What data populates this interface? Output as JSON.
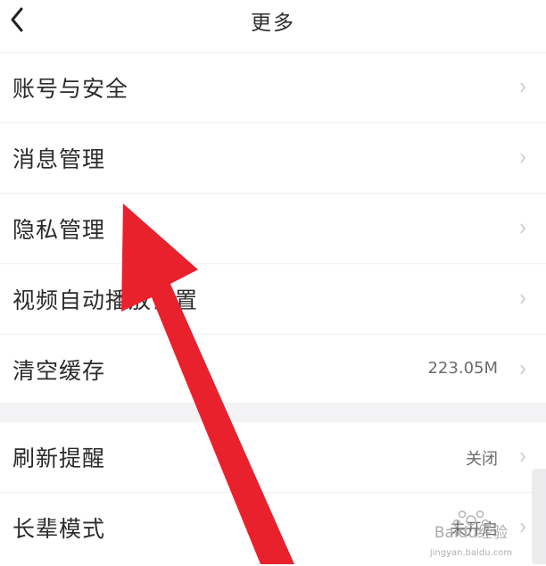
{
  "header": {
    "title": "更多",
    "back_icon": "chevron-left-icon"
  },
  "settings": {
    "group1": [
      {
        "label": "账号与安全",
        "value": ""
      },
      {
        "label": "消息管理",
        "value": ""
      },
      {
        "label": "隐私管理",
        "value": ""
      },
      {
        "label": "视频自动播放设置",
        "value": ""
      },
      {
        "label": "清空缓存",
        "value": "223.05M"
      }
    ],
    "group2": [
      {
        "label": "刷新提醒",
        "value": "关闭"
      },
      {
        "label": "长辈模式",
        "value": "未开启"
      }
    ]
  },
  "overlay": {
    "arrow_color": "#e8212c",
    "watermark": "Baidu经验",
    "watermark_sub": "jingyan.baidu.com"
  },
  "colors": {
    "background": "#ffffff",
    "divider": "#f0f0f0",
    "group_gap": "#f3f3f5"
  }
}
